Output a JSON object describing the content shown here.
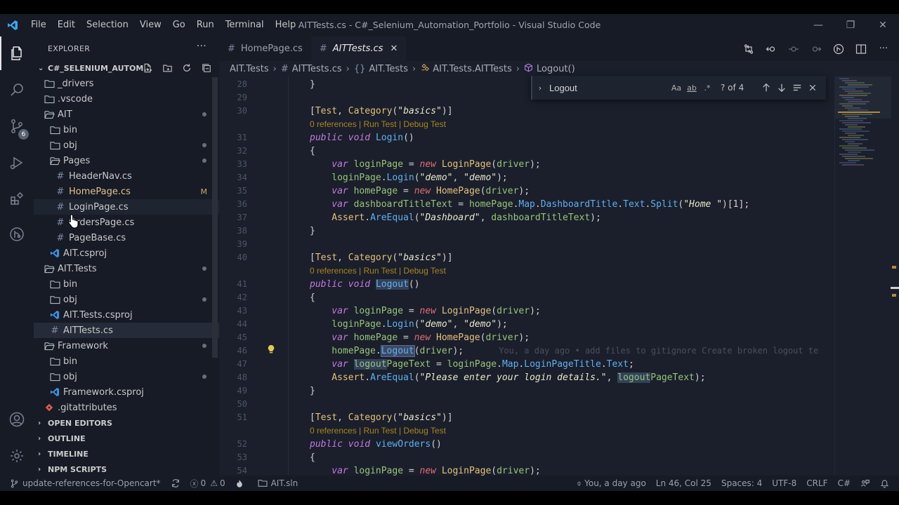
{
  "window": {
    "title": "AITTests.cs - C#_Selenium_Automation_Portfolio - Visual Studio Code",
    "menu": [
      "File",
      "Edit",
      "Selection",
      "View",
      "Go",
      "Run",
      "Terminal",
      "Help"
    ],
    "minimize": "—",
    "restore": "❐",
    "close": "✕"
  },
  "activity": {
    "scm_badge": "6"
  },
  "sidebar": {
    "header": "EXPLORER",
    "more": "···",
    "workspace": "C#_SELENIUM_AUTOM...",
    "tree": [
      {
        "label": "_drivers",
        "type": "folder",
        "depth": 0
      },
      {
        "label": ".vscode",
        "type": "folder",
        "depth": 0
      },
      {
        "label": "AIT",
        "type": "folder-open",
        "depth": 0,
        "dot": true
      },
      {
        "label": "bin",
        "type": "folder",
        "depth": 1
      },
      {
        "label": "obj",
        "type": "folder",
        "depth": 1,
        "dot": true
      },
      {
        "label": "Pages",
        "type": "folder-open",
        "depth": 1,
        "dot": true
      },
      {
        "label": "HeaderNav.cs",
        "type": "cs",
        "depth": 2
      },
      {
        "label": "HomePage.cs",
        "type": "cs",
        "depth": 2,
        "mod": "M"
      },
      {
        "label": "LoginPage.cs",
        "type": "cs",
        "depth": 2,
        "hover": true
      },
      {
        "label": "OrdersPage.cs",
        "type": "cs",
        "depth": 2
      },
      {
        "label": "PageBase.cs",
        "type": "cs",
        "depth": 2
      },
      {
        "label": "AIT.csproj",
        "type": "proj",
        "depth": 1
      },
      {
        "label": "AIT.Tests",
        "type": "folder-open",
        "depth": 0,
        "dot": true
      },
      {
        "label": "bin",
        "type": "folder",
        "depth": 1
      },
      {
        "label": "obj",
        "type": "folder",
        "depth": 1,
        "dot": true
      },
      {
        "label": "AIT.Tests.csproj",
        "type": "proj",
        "depth": 1
      },
      {
        "label": "AITTests.cs",
        "type": "cs",
        "depth": 1,
        "selected": true
      },
      {
        "label": "Framework",
        "type": "folder-open",
        "depth": 0,
        "dot": true
      },
      {
        "label": "bin",
        "type": "folder",
        "depth": 1
      },
      {
        "label": "obj",
        "type": "folder",
        "depth": 1,
        "dot": true
      },
      {
        "label": "Framework.csproj",
        "type": "proj",
        "depth": 1
      },
      {
        "label": ".gitattributes",
        "type": "git",
        "depth": 0
      }
    ],
    "sections": [
      "OPEN EDITORS",
      "OUTLINE",
      "TIMELINE",
      "NPM SCRIPTS"
    ]
  },
  "tabs": [
    {
      "label": "HomePage.cs",
      "active": false
    },
    {
      "label": "AITTests.cs",
      "active": true,
      "close": "✕"
    }
  ],
  "breadcrumbs": {
    "project": "AIT.Tests",
    "file": "AITTests.cs",
    "namespace": "AIT.Tests",
    "class": "AIT.Tests.AITTests",
    "method": "Logout()"
  },
  "find": {
    "query": "Logout",
    "opt_case": "Aa",
    "opt_word": "ab",
    "opt_regex": ".*",
    "count": "? of 4"
  },
  "codelens_text": "0 references | Run Test | Debug Test",
  "blame": "You, a day ago • add files to gitignore Create broken logout te",
  "code_lines": [
    {
      "n": "28",
      "i": 2,
      "t": [
        [
          "}",
          "pun"
        ]
      ]
    },
    {
      "n": "29",
      "i": 0,
      "t": []
    },
    {
      "n": "30",
      "i": 2,
      "t": [
        [
          "[",
          "pun"
        ],
        [
          "Test",
          "attr"
        ],
        [
          ", ",
          "pun"
        ],
        [
          "Category",
          "attr"
        ],
        [
          "(",
          "pun"
        ],
        [
          "\"basics\"",
          "str"
        ],
        [
          ")]",
          "pun"
        ]
      ]
    },
    {
      "lens": true
    },
    {
      "n": "31",
      "i": 2,
      "t": [
        [
          "public",
          "kw"
        ],
        [
          " ",
          "plain"
        ],
        [
          "void",
          "kw"
        ],
        [
          " ",
          "plain"
        ],
        [
          "Login",
          "fn"
        ],
        [
          "()",
          "pun"
        ]
      ]
    },
    {
      "n": "32",
      "i": 2,
      "t": [
        [
          "{",
          "pun"
        ]
      ]
    },
    {
      "n": "33",
      "i": 3,
      "t": [
        [
          "var",
          "kw"
        ],
        [
          " ",
          "plain"
        ],
        [
          "loginPage",
          "var"
        ],
        [
          " = ",
          "pun"
        ],
        [
          "new",
          "kw2"
        ],
        [
          " ",
          "plain"
        ],
        [
          "LoginPage",
          "ty"
        ],
        [
          "(",
          "pun"
        ],
        [
          "driver",
          "var"
        ],
        [
          ");",
          "pun"
        ]
      ]
    },
    {
      "n": "34",
      "i": 3,
      "t": [
        [
          "loginPage",
          "var"
        ],
        [
          ".",
          "pun"
        ],
        [
          "Login",
          "fn"
        ],
        [
          "(",
          "pun"
        ],
        [
          "\"demo\"",
          "str"
        ],
        [
          ", ",
          "pun"
        ],
        [
          "\"demo\"",
          "str"
        ],
        [
          ");",
          "pun"
        ]
      ]
    },
    {
      "n": "35",
      "i": 3,
      "t": [
        [
          "var",
          "kw"
        ],
        [
          " ",
          "plain"
        ],
        [
          "homePage",
          "var"
        ],
        [
          " = ",
          "pun"
        ],
        [
          "new",
          "kw2"
        ],
        [
          " ",
          "plain"
        ],
        [
          "HomePage",
          "ty"
        ],
        [
          "(",
          "pun"
        ],
        [
          "driver",
          "var"
        ],
        [
          ");",
          "pun"
        ]
      ]
    },
    {
      "n": "36",
      "i": 3,
      "t": [
        [
          "var",
          "kw"
        ],
        [
          " ",
          "plain"
        ],
        [
          "dashboardTitleText",
          "var"
        ],
        [
          " = ",
          "pun"
        ],
        [
          "homePage",
          "var"
        ],
        [
          ".",
          "pun"
        ],
        [
          "Map",
          "fn"
        ],
        [
          ".",
          "pun"
        ],
        [
          "DashboardTitle",
          "fn"
        ],
        [
          ".",
          "pun"
        ],
        [
          "Text",
          "fn"
        ],
        [
          ".",
          "pun"
        ],
        [
          "Split",
          "fn"
        ],
        [
          "(",
          "pun"
        ],
        [
          "\"Home \"",
          "str"
        ],
        [
          ")[1];",
          "pun"
        ]
      ]
    },
    {
      "n": "37",
      "i": 3,
      "t": [
        [
          "Assert",
          "ty"
        ],
        [
          ".",
          "pun"
        ],
        [
          "AreEqual",
          "fn"
        ],
        [
          "(",
          "pun"
        ],
        [
          "\"Dashboard\"",
          "str"
        ],
        [
          ", ",
          "pun"
        ],
        [
          "dashboardTitleText",
          "var"
        ],
        [
          ");",
          "pun"
        ]
      ]
    },
    {
      "n": "38",
      "i": 2,
      "t": [
        [
          "}",
          "pun"
        ]
      ]
    },
    {
      "n": "39",
      "i": 0,
      "t": []
    },
    {
      "n": "40",
      "i": 2,
      "t": [
        [
          "[",
          "pun"
        ],
        [
          "Test",
          "attr"
        ],
        [
          ", ",
          "pun"
        ],
        [
          "Category",
          "attr"
        ],
        [
          "(",
          "pun"
        ],
        [
          "\"basics\"",
          "str"
        ],
        [
          ")]",
          "pun"
        ]
      ]
    },
    {
      "lens": true
    },
    {
      "n": "41",
      "i": 2,
      "t": [
        [
          "public",
          "kw"
        ],
        [
          " ",
          "plain"
        ],
        [
          "void",
          "kw"
        ],
        [
          " ",
          "plain"
        ],
        [
          "Logout",
          "fn hl"
        ],
        [
          "()",
          "pun"
        ]
      ]
    },
    {
      "n": "42",
      "i": 2,
      "t": [
        [
          "{",
          "pun"
        ]
      ]
    },
    {
      "n": "43",
      "i": 3,
      "t": [
        [
          "var",
          "kw"
        ],
        [
          " ",
          "plain"
        ],
        [
          "loginPage",
          "var"
        ],
        [
          " = ",
          "pun"
        ],
        [
          "new",
          "kw2"
        ],
        [
          " ",
          "plain"
        ],
        [
          "LoginPage",
          "ty"
        ],
        [
          "(",
          "pun"
        ],
        [
          "driver",
          "var"
        ],
        [
          ");",
          "pun"
        ]
      ]
    },
    {
      "n": "44",
      "i": 3,
      "t": [
        [
          "loginPage",
          "var"
        ],
        [
          ".",
          "pun"
        ],
        [
          "Login",
          "fn"
        ],
        [
          "(",
          "pun"
        ],
        [
          "\"demo\"",
          "str"
        ],
        [
          ", ",
          "pun"
        ],
        [
          "\"demo\"",
          "str"
        ],
        [
          ");",
          "pun"
        ]
      ]
    },
    {
      "n": "45",
      "i": 3,
      "t": [
        [
          "var",
          "kw"
        ],
        [
          " ",
          "plain"
        ],
        [
          "homePage",
          "var"
        ],
        [
          " = ",
          "pun"
        ],
        [
          "new",
          "kw2"
        ],
        [
          " ",
          "plain"
        ],
        [
          "HomePage",
          "ty"
        ],
        [
          "(",
          "pun"
        ],
        [
          "driver",
          "var"
        ],
        [
          ");",
          "pun"
        ]
      ]
    },
    {
      "n": "46",
      "i": 3,
      "bulb": true,
      "blame": true,
      "t": [
        [
          "homePage",
          "var"
        ],
        [
          ".",
          "pun"
        ],
        [
          "Logout",
          "fn hl2"
        ],
        [
          "(",
          "pun"
        ],
        [
          "driver",
          "var"
        ],
        [
          ");",
          "pun"
        ]
      ]
    },
    {
      "n": "47",
      "i": 3,
      "t": [
        [
          "var",
          "kw"
        ],
        [
          " ",
          "plain"
        ],
        [
          "logout",
          "var hl"
        ],
        [
          "PageText",
          "var"
        ],
        [
          " = ",
          "pun"
        ],
        [
          "loginPage",
          "var"
        ],
        [
          ".",
          "pun"
        ],
        [
          "Map",
          "fn"
        ],
        [
          ".",
          "pun"
        ],
        [
          "LoginPageTitle",
          "fn"
        ],
        [
          ".",
          "pun"
        ],
        [
          "Text",
          "fn"
        ],
        [
          ";",
          "pun"
        ]
      ]
    },
    {
      "n": "48",
      "i": 3,
      "t": [
        [
          "Assert",
          "ty"
        ],
        [
          ".",
          "pun"
        ],
        [
          "AreEqual",
          "fn"
        ],
        [
          "(",
          "pun"
        ],
        [
          "\"Please enter your login details.\"",
          "str"
        ],
        [
          ", ",
          "pun"
        ],
        [
          "logout",
          "var hl"
        ],
        [
          "PageText",
          "var"
        ],
        [
          ");",
          "pun"
        ]
      ]
    },
    {
      "n": "49",
      "i": 2,
      "t": [
        [
          "}",
          "pun"
        ]
      ]
    },
    {
      "n": "50",
      "i": 0,
      "t": []
    },
    {
      "n": "51",
      "i": 2,
      "t": [
        [
          "[",
          "pun"
        ],
        [
          "Test",
          "attr"
        ],
        [
          ", ",
          "pun"
        ],
        [
          "Category",
          "attr"
        ],
        [
          "(",
          "pun"
        ],
        [
          "\"basics\"",
          "str"
        ],
        [
          ")]",
          "pun"
        ]
      ]
    },
    {
      "lens": true
    },
    {
      "n": "52",
      "i": 2,
      "t": [
        [
          "public",
          "kw"
        ],
        [
          " ",
          "plain"
        ],
        [
          "void",
          "kw"
        ],
        [
          " ",
          "plain"
        ],
        [
          "viewOrders",
          "fn"
        ],
        [
          "()",
          "pun"
        ]
      ]
    },
    {
      "n": "53",
      "i": 2,
      "t": [
        [
          "{",
          "pun"
        ]
      ]
    },
    {
      "n": "54",
      "i": 3,
      "t": [
        [
          "var",
          "kw"
        ],
        [
          " ",
          "plain"
        ],
        [
          "loginPage",
          "var"
        ],
        [
          " = ",
          "pun"
        ],
        [
          "new",
          "kw2"
        ],
        [
          " ",
          "plain"
        ],
        [
          "LoginPage",
          "ty"
        ],
        [
          "(",
          "pun"
        ],
        [
          "driver",
          "var"
        ],
        [
          ");",
          "pun"
        ]
      ]
    }
  ],
  "status": {
    "branch": "update-references-for-Opencart*",
    "errors": "0",
    "warnings": "0",
    "solution": "AIT.sln",
    "blame": "You, a day ago",
    "position": "Ln 46, Col 25",
    "spaces": "Spaces: 4",
    "encoding": "UTF-8",
    "eol": "CRLF",
    "language": "C#"
  },
  "colors": {
    "accent": "#3ca6ea",
    "modified": "#e2c08d",
    "csharp_icon": "#519aba"
  }
}
